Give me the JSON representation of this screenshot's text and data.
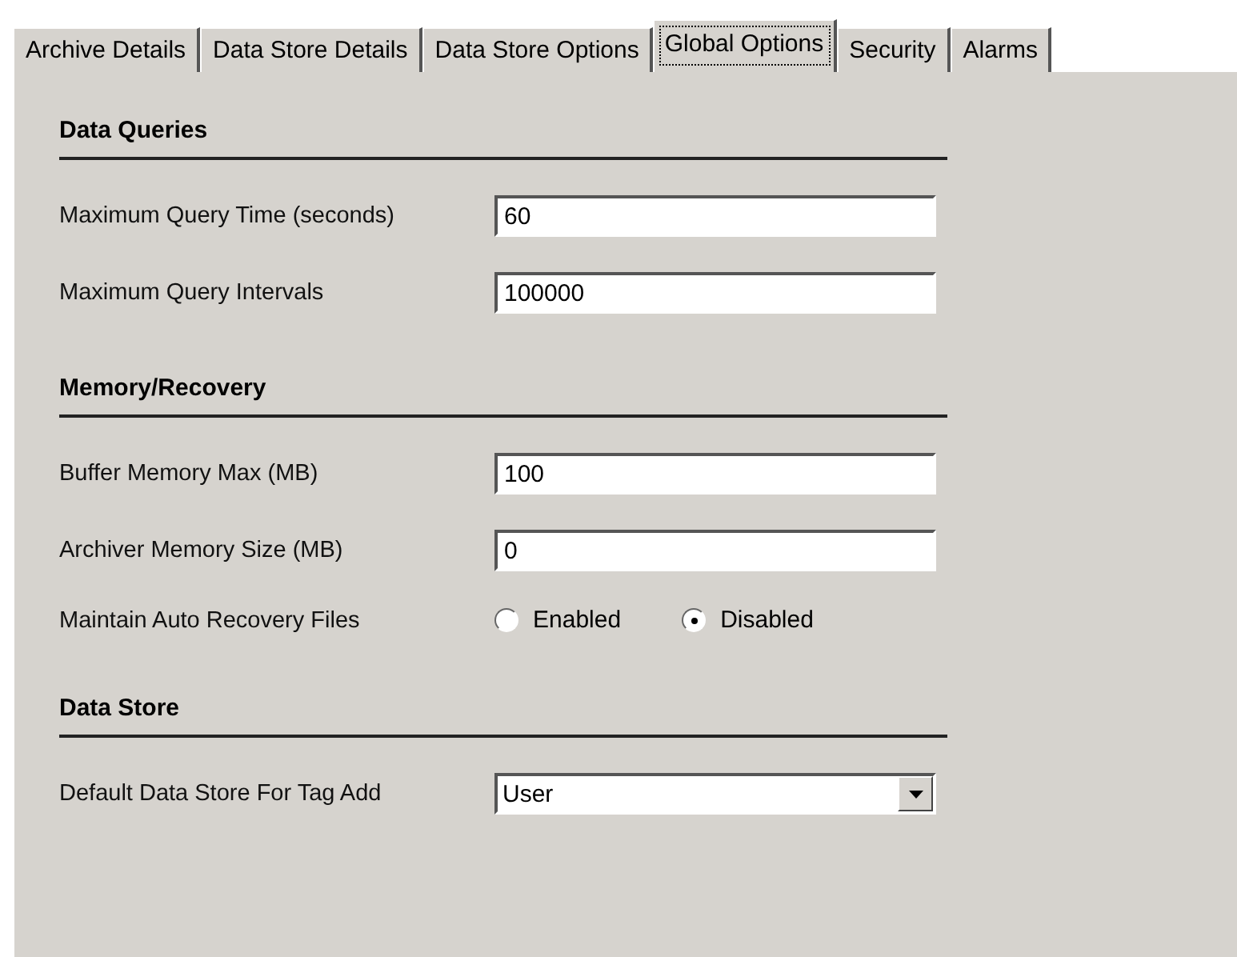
{
  "tabs": [
    {
      "label": "Archive Details",
      "selected": false
    },
    {
      "label": "Data Store Details",
      "selected": false
    },
    {
      "label": "Data Store Options",
      "selected": false
    },
    {
      "label": "Global Options",
      "selected": true
    },
    {
      "label": "Security",
      "selected": false
    },
    {
      "label": "Alarms",
      "selected": false
    }
  ],
  "sections": [
    {
      "title": "Data Queries",
      "rows": [
        {
          "kind": "text",
          "label": "Maximum Query Time (seconds)",
          "value": "60"
        },
        {
          "kind": "text",
          "label": "Maximum Query Intervals",
          "value": "100000"
        }
      ]
    },
    {
      "title": "Memory/Recovery",
      "rows": [
        {
          "kind": "text",
          "label": "Buffer Memory Max (MB)",
          "value": "100"
        },
        {
          "kind": "text",
          "label": "Archiver Memory Size (MB)",
          "value": "0"
        },
        {
          "kind": "radio",
          "label": "Maintain Auto Recovery Files",
          "options": [
            {
              "label": "Enabled",
              "selected": false
            },
            {
              "label": "Disabled",
              "selected": true
            }
          ]
        }
      ]
    },
    {
      "title": "Data Store",
      "rows": [
        {
          "kind": "select",
          "label": "Default Data Store For Tag Add",
          "value": "User"
        }
      ]
    }
  ]
}
